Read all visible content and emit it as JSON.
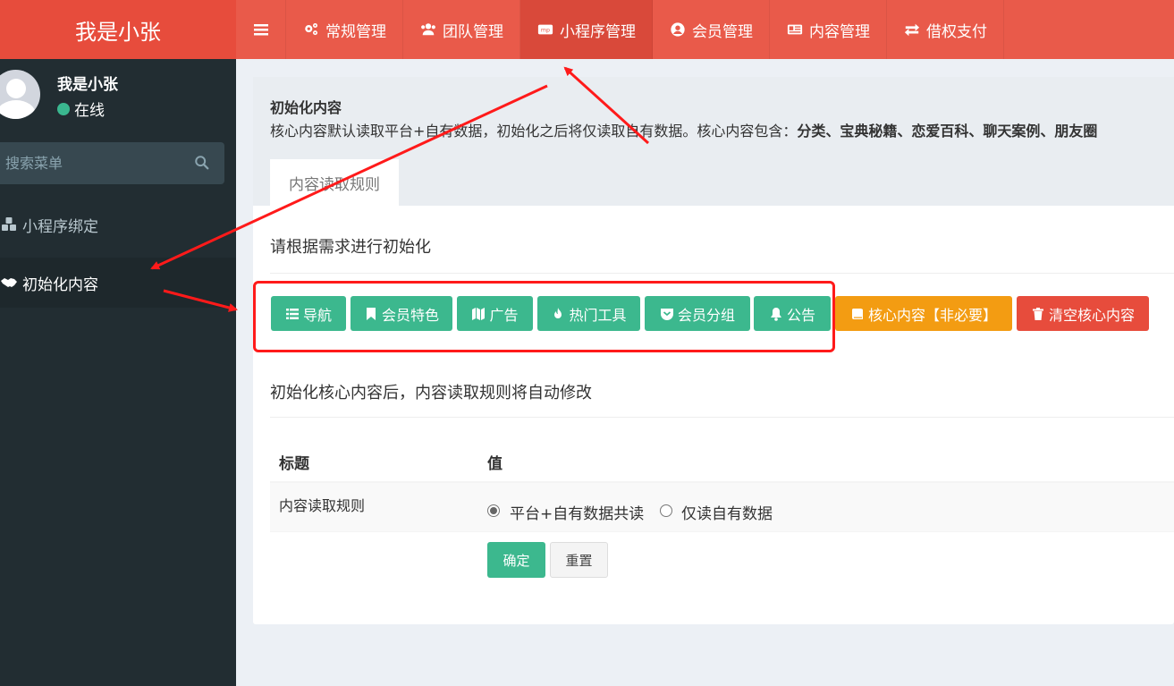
{
  "brand": {
    "title": "我是小张"
  },
  "topnav": {
    "items": [
      {
        "label": "常规管理",
        "icon": "gears-icon"
      },
      {
        "label": "团队管理",
        "icon": "users-icon"
      },
      {
        "label": "小程序管理",
        "icon": "mp-icon",
        "badge": "mp",
        "active": true
      },
      {
        "label": "会员管理",
        "icon": "user-circle-icon"
      },
      {
        "label": "内容管理",
        "icon": "newspaper-icon"
      },
      {
        "label": "借权支付",
        "icon": "exchange-icon"
      }
    ]
  },
  "sidebar": {
    "user_name": "我是小张",
    "status": "在线",
    "search_placeholder": "搜索菜单",
    "items": [
      {
        "label": "小程序绑定",
        "icon": "cubes-icon"
      },
      {
        "label": "初始化内容",
        "icon": "handshake-icon",
        "active": true
      }
    ]
  },
  "header": {
    "title": "初始化内容",
    "desc_prefix": "核心内容默认读取平台+自有数据，初始化之后将仅读取自有数据。核心内容包含：",
    "desc_bold": "分类、宝典秘籍、恋爱百科、聊天案例、朋友圈",
    "tab": "内容读取规则"
  },
  "main": {
    "section1_title": "请根据需求进行初始化",
    "buttons": [
      {
        "label": "导航",
        "icon": "list-icon",
        "color": "#3cb88e"
      },
      {
        "label": "会员特色",
        "icon": "bookmark-icon",
        "color": "#3cb88e"
      },
      {
        "label": "广告",
        "icon": "map-icon",
        "color": "#3cb88e"
      },
      {
        "label": "热门工具",
        "icon": "fire-icon",
        "color": "#3cb88e"
      },
      {
        "label": "会员分组",
        "icon": "pocket-icon",
        "color": "#3cb88e"
      },
      {
        "label": "公告",
        "icon": "bell-icon",
        "color": "#3cb88e"
      },
      {
        "label": "核心内容【非必要】",
        "icon": "book-icon",
        "color": "#f39c12"
      },
      {
        "label": "清空核心内容",
        "icon": "trash-icon",
        "color": "#e74c3c"
      }
    ],
    "section2_title": "初始化核心内容后，内容读取规则将自动修改",
    "table": {
      "headers": [
        "标题",
        "值"
      ],
      "row_label": "内容读取规则",
      "options": [
        {
          "label": "平台+自有数据共读",
          "checked": true
        },
        {
          "label": "仅读自有数据",
          "checked": false
        }
      ]
    },
    "confirm_label": "确定",
    "reset_label": "重置"
  },
  "colors": {
    "header": "#e95a4a",
    "logo": "#e74c3c",
    "sidebar": "#222d32",
    "primary": "#3cb88e",
    "annotation": "#ff1a1a"
  }
}
